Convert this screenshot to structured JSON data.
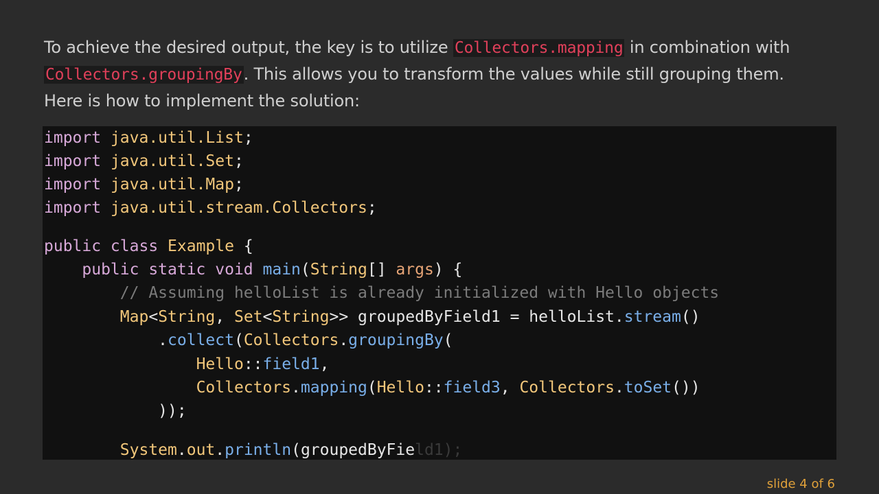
{
  "intro": {
    "l1_pre": "To achieve the desired output, the key is to utilize ",
    "l1_code": "Collectors.mapping",
    "l1_post": " in combination with",
    "l2_code": "Collectors.groupingBy",
    "l2_post": ". This allows you to transform the values while still grouping them.",
    "l3": "Here is how to implement the solution:"
  },
  "code": {
    "line1": {
      "kw": "import",
      "pkg": " java.util.List",
      "end": ";"
    },
    "line2": {
      "kw": "import",
      "pkg": " java.util.Set",
      "end": ";"
    },
    "line3": {
      "kw": "import",
      "pkg": " java.util.Map",
      "end": ";"
    },
    "line4": {
      "kw": "import",
      "pkg": " java.util.stream.Collectors",
      "end": ";"
    },
    "line5": {
      "kw": "public class",
      "cls": "Example",
      "rest": " {"
    },
    "line6": {
      "kw": "public static void",
      "fn": "main",
      "open": "(",
      "ty": "String",
      "br": "[]",
      "arg": "args",
      "close": ") {"
    },
    "line7": {
      "comment": "// Assuming helloList is already initialized with Hello objects"
    },
    "line8": {
      "t1": "Map",
      "lt1": "<",
      "t2": "String",
      "c": ", ",
      "t3": "Set",
      "lt2": "<",
      "t4": "String",
      "gt": ">> groupedByField1 = helloList.",
      "fn": "stream",
      "end": "()"
    },
    "line9": {
      "dot": ".",
      "fn1": "collect",
      "p": "(",
      "t": "Collectors",
      "dot2": ".",
      "fn2": "groupingBy",
      "end": "("
    },
    "line10": {
      "t": "Hello",
      "sep": "::",
      "fn": "field1",
      "end": ","
    },
    "line11": {
      "t1": "Collectors",
      "d1": ".",
      "fn1": "mapping",
      "p1": "(",
      "t2": "Hello",
      "sep": "::",
      "fn2": "field3",
      "c": ", ",
      "t3": "Collectors",
      "d2": ".",
      "fn3": "toSet",
      "end": "())"
    },
    "line12": {
      "text": "));"
    },
    "line13": {
      "t": "System",
      "d1": ".",
      "out": "out",
      "d2": ".",
      "fn": "println",
      "p": "(",
      "arg": "groupedByFie",
      "faded": "ld1);"
    }
  },
  "footer": {
    "slide_label": "slide 4 of 6"
  }
}
